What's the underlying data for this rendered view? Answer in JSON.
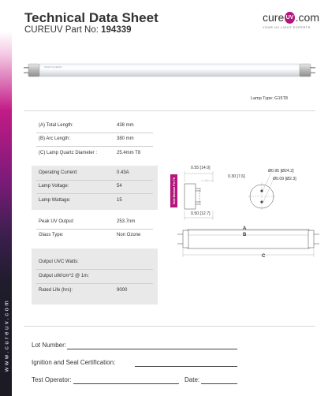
{
  "header": {
    "title": "Technical Data Sheet",
    "part_prefix": "CUREUV Part No: ",
    "part_number": "194339"
  },
  "logo": {
    "word_left": "cure",
    "word_badge": "UV",
    "word_right": ".com",
    "tagline": "YOUR UV LIGHT EXPERTS",
    "brand_color": "#b5157c"
  },
  "lamp": {
    "caption": "Lamp Type: G15T8",
    "etched_text": "SANKYO DENKI"
  },
  "dimensions": [
    {
      "label": "(A) Total Length:",
      "value": "438 mm"
    },
    {
      "label": "(B) Arc Length:",
      "value": "380 mm"
    },
    {
      "label": "(C) Lamp Quartz Diameter :",
      "value": "25.4mm T8"
    }
  ],
  "electrical": [
    {
      "label": "Operating Current:",
      "value": "0.43A"
    },
    {
      "label": "Lamp Voltage:",
      "value": "54"
    },
    {
      "label": "Lamp Wattage:",
      "value": "15"
    }
  ],
  "output": [
    {
      "label": "Peak UV Output:",
      "value": "253.7nm"
    },
    {
      "label": "Glass Type:",
      "value": "Non Ozone"
    }
  ],
  "uvc": [
    {
      "label": "Output UVC Watts:",
      "value": ""
    },
    {
      "label": "Output uW/cm^2 @ 1m:",
      "value": ""
    },
    {
      "label": "Rated Life (hrs):",
      "value": "9000"
    }
  ],
  "spec_tab": "Side Medium Pin T8",
  "diagram": {
    "dim_055": "0.55 [14.0]",
    "dim_030": "0.30 [7.6]",
    "dim_050": "0.50 [12.7]",
    "dim_095": "Ø0.95 [Ø24.2]",
    "dim_009": "Ø0.09 [Ø2.3]",
    "label_a": "A",
    "label_b": "B",
    "label_c": "C"
  },
  "form": {
    "lot": "Lot Number:",
    "ignition": "Ignition and Seal Certification:",
    "operator": "Test Operator:",
    "date": "Date:"
  },
  "sidebar_url": "www.cureuv.com"
}
